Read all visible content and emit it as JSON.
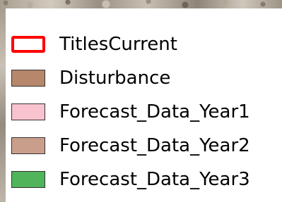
{
  "legend": {
    "items": [
      {
        "label": "TitlesCurrent",
        "symbol": "outline",
        "color": "#ff0000"
      },
      {
        "label": "Disturbance",
        "symbol": "fill",
        "color": "#b6876a"
      },
      {
        "label": "Forecast_Data_Year1",
        "symbol": "fill",
        "color": "#f8c3cf"
      },
      {
        "label": "Forecast_Data_Year2",
        "symbol": "fill",
        "color": "#c99f8c"
      },
      {
        "label": "Forecast_Data_Year3",
        "symbol": "fill",
        "color": "#4fb45a"
      }
    ]
  }
}
